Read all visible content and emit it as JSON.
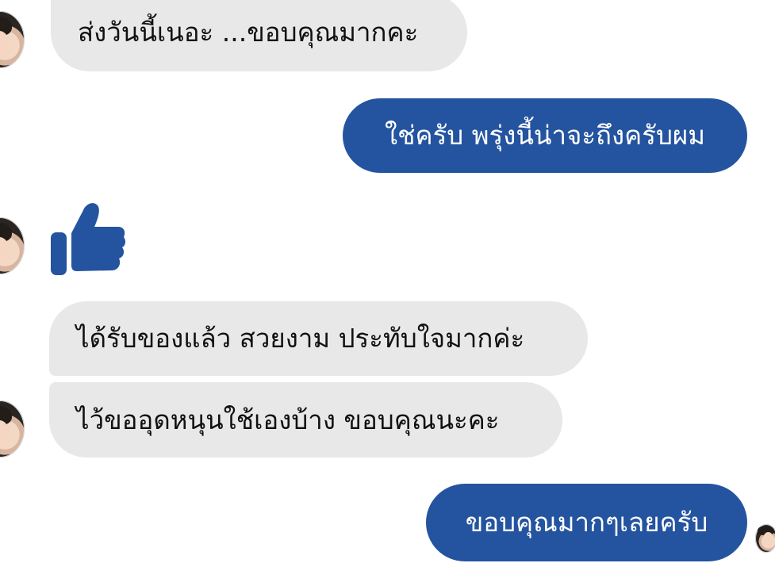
{
  "messages": [
    {
      "sender": "other",
      "text": "ส่งวันนี้เนอะ ...ขอบคุณมากคะ"
    },
    {
      "sender": "me",
      "text": "ใช่ครับ พรุ่งนี้น่าจะถึงครับผม"
    },
    {
      "sender": "other",
      "reaction": "thumbs-up-icon"
    },
    {
      "sender": "other",
      "text": "ได้รับของแล้ว สวยงาม ประทับใจมากค่ะ"
    },
    {
      "sender": "other",
      "text": "ไว้ขออุดหนุนใช้เองบ้าง ขอบคุณนะคะ"
    },
    {
      "sender": "me",
      "text": "ขอบคุณมากๆเลยครับ"
    }
  ],
  "colors": {
    "incoming_bg": "#e8e8e8",
    "outgoing_bg": "#24549f",
    "thumb": "#24549f"
  }
}
